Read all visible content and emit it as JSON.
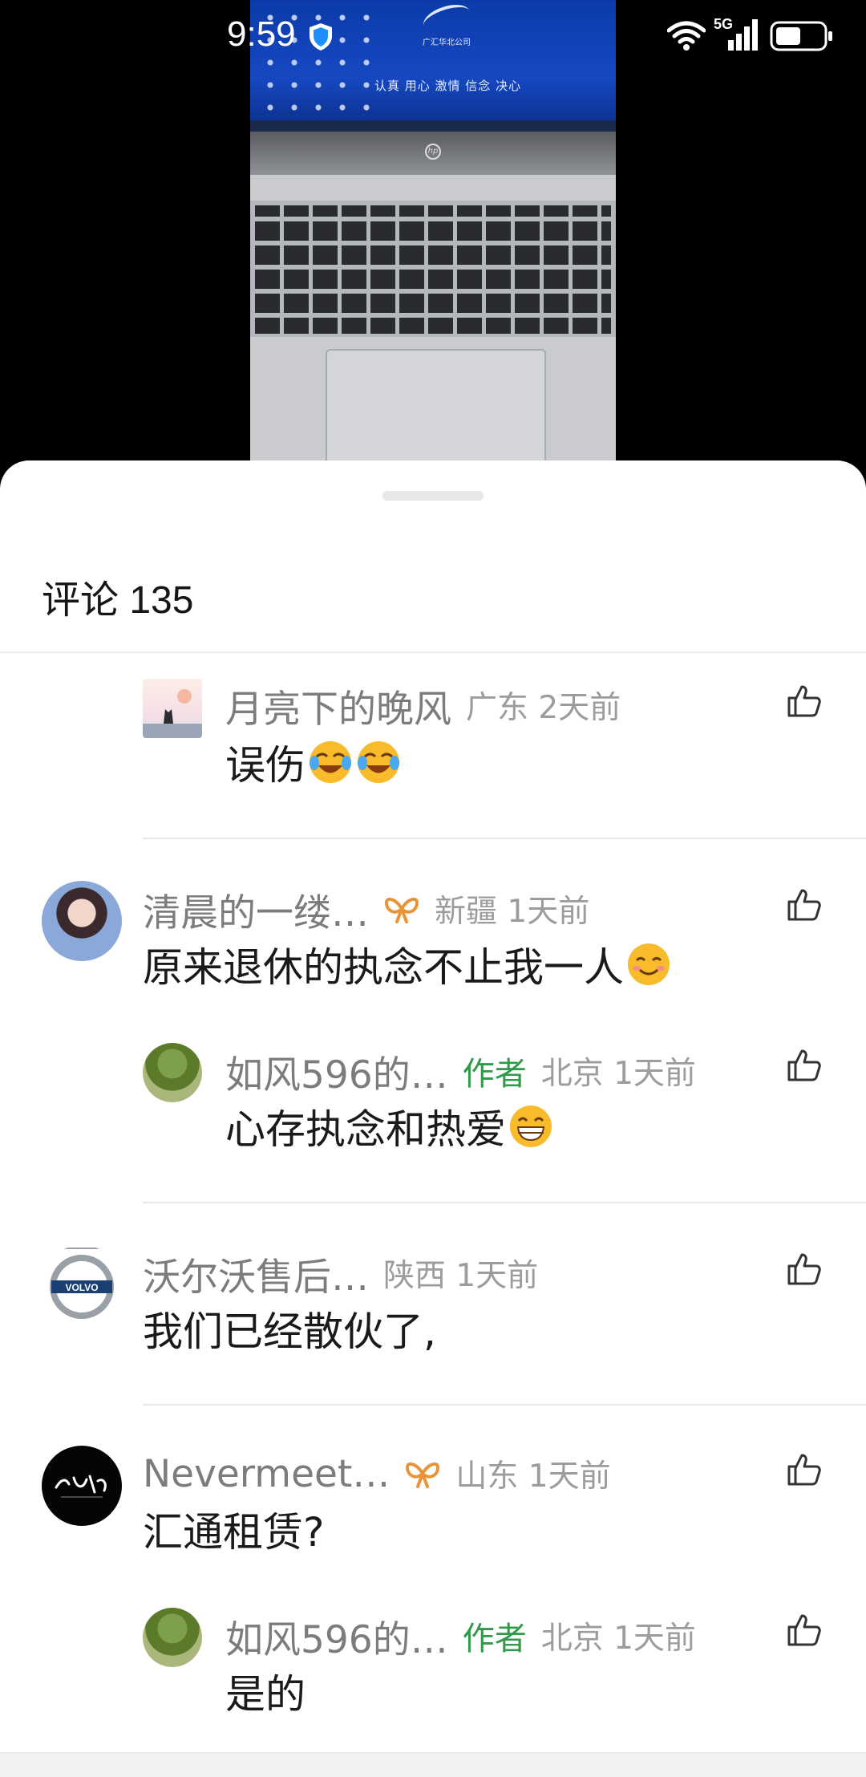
{
  "status_bar": {
    "time": "9:59",
    "network": "5G",
    "icons": [
      "shield-icon",
      "wifi-icon",
      "signal-icon",
      "battery-icon"
    ]
  },
  "video": {
    "company_name": "广汇华北公司",
    "slogan": "认真 用心 激情 信念 决心"
  },
  "comments_header": {
    "title": "评论 135"
  },
  "comments": [
    {
      "kind": "reply",
      "name": "月亮下的晚风",
      "region_time": "广东 2天前",
      "text": "误伤",
      "emojis": [
        "crying-laughing-emoji",
        "crying-laughing-emoji"
      ]
    },
    {
      "kind": "top",
      "name": "清晨的一缕…",
      "badge_icon": "bow-icon",
      "region_time": "新疆 1天前",
      "text": "原来退休的执念不止我一人",
      "emojis": [
        "smile-emoji"
      ]
    },
    {
      "kind": "reply",
      "name": "如风596的…",
      "author_badge": "作者",
      "region_time": "北京 1天前",
      "text": "心存执念和热爱",
      "emojis": [
        "grin-emoji"
      ]
    },
    {
      "kind": "top",
      "name": "沃尔沃售后…",
      "region_time": "陕西 1天前",
      "text": "我们已经散伙了,"
    },
    {
      "kind": "top",
      "name": "Nevermeet…",
      "badge_icon": "bow-icon",
      "region_time": "山东 1天前",
      "text": "汇通租赁?"
    },
    {
      "kind": "reply",
      "name": "如风596的…",
      "author_badge": "作者",
      "region_time": "北京 1天前",
      "text": "是的"
    }
  ],
  "colors": {
    "name": "#7c7c7c",
    "author_badge": "#2f9a4a",
    "region_time": "#9c9c9c",
    "bow_icon": "#e8953a"
  }
}
